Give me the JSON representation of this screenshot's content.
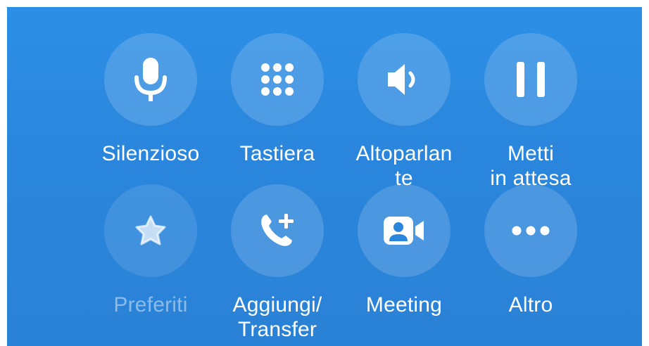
{
  "controls": {
    "row1": [
      {
        "label": "Silenzioso",
        "icon": "microphone-icon"
      },
      {
        "label": "Tastiera",
        "icon": "keypad-icon"
      },
      {
        "label": "Altoparlan\nte",
        "icon": "speaker-icon"
      },
      {
        "label": "Metti\nin attesa",
        "icon": "pause-icon"
      }
    ],
    "row2": [
      {
        "label": "Preferiti",
        "icon": "star-icon",
        "enabled": false
      },
      {
        "label": "Aggiungi/\nTransfer",
        "icon": "add-call-icon"
      },
      {
        "label": "Meeting",
        "icon": "video-meeting-icon"
      },
      {
        "label": "Altro",
        "icon": "more-icon"
      }
    ]
  },
  "colors": {
    "background": "#2a86dc",
    "circle": "rgba(255,255,255,0.16)",
    "text": "#ffffff",
    "disabled_text": "rgba(255,255,255,0.45)"
  }
}
